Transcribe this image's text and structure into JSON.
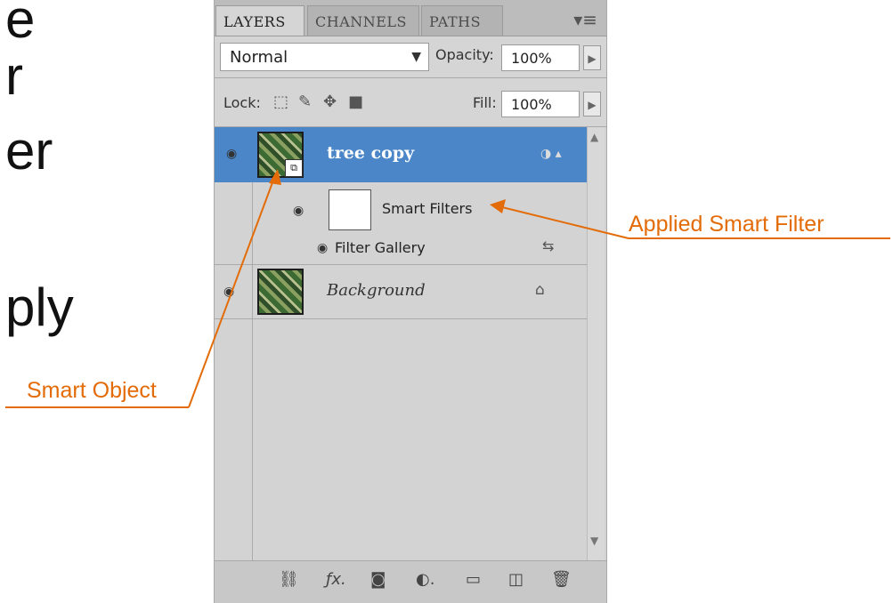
{
  "slide": {
    "fragments": [
      "e",
      "r",
      "er",
      "ply"
    ]
  },
  "panel": {
    "tabs": [
      {
        "label": "LAYERS",
        "active": true
      },
      {
        "label": "CHANNELS",
        "active": false
      },
      {
        "label": "PATHS",
        "active": false
      }
    ],
    "menu_icon": "panel-menu-icon",
    "blend_mode": "Normal",
    "opacity_label": "Opacity:",
    "opacity_value": "100%",
    "lock_label": "Lock:",
    "fill_label": "Fill:",
    "fill_value": "100%"
  },
  "layers": {
    "selected": {
      "name": "tree copy"
    },
    "smart_filters": "Smart Filters",
    "filter_gallery": "Filter Gallery",
    "background": {
      "name": "Background"
    }
  },
  "annotations": {
    "applied_filter": "Applied Smart Filter",
    "smart_object": "Smart Object",
    "color": "#e36c09"
  },
  "colors": {
    "selected_row": "#4a86c8",
    "panel_bg": "#d5d5d5"
  }
}
